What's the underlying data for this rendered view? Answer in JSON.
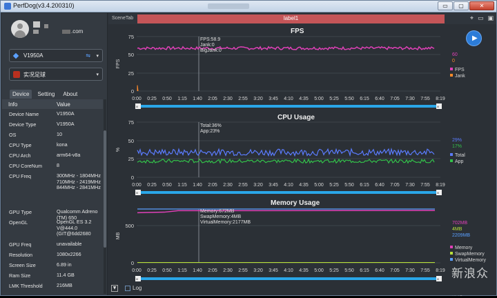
{
  "window": {
    "title": "PerfDog(v3.4.200310)",
    "btn_min": "▭",
    "btn_max": "▢",
    "btn_close": "✕"
  },
  "account": {
    "email_suffix": ".com"
  },
  "device_select": {
    "label": "V1950A",
    "chevron": "▾"
  },
  "app_select": {
    "label": "实况足球",
    "chevron": "▾"
  },
  "tabs": [
    "Device",
    "Setting",
    "About"
  ],
  "info": {
    "header": [
      "Info",
      "Value"
    ],
    "rows": [
      {
        "k": "Device Name",
        "v": "V1950A"
      },
      {
        "k": "Device Type",
        "v": "V1950A"
      },
      {
        "k": "OS",
        "v": "10"
      },
      {
        "k": "CPU Type",
        "v": "kona"
      },
      {
        "k": "CPU Arch",
        "v": "arm64-v8a"
      },
      {
        "k": "CPU CoreNum",
        "v": "8"
      },
      {
        "k": "CPU Freq",
        "v": "300MHz - 1804MHz 710MHz - 2419MHz 844MHz - 2841MHz"
      },
      {
        "k": "GPU Type",
        "v": "Qualcomm Adreno (TM) 650"
      },
      {
        "k": "OpenGL",
        "v": "OpenGL ES 3.2 V@444.0 (GIT@6dd2680"
      },
      {
        "k": "GPU Freq",
        "v": "unavailable"
      },
      {
        "k": "Resolution",
        "v": "1080x2266"
      },
      {
        "k": "Screen Size",
        "v": "6.89 in"
      },
      {
        "k": "Ram Size",
        "v": "11.4 GB"
      },
      {
        "k": "LMK Threshold",
        "v": "216MB"
      }
    ]
  },
  "topbar": {
    "scene_tab": "SceneTab",
    "label": "label1"
  },
  "time_ticks": [
    "0:00",
    "0:25",
    "0:50",
    "1:15",
    "1:40",
    "2:05",
    "2:30",
    "2:55",
    "3:20",
    "3:45",
    "4:10",
    "4:35",
    "5:00",
    "5:25",
    "5:50",
    "6:15",
    "6:40",
    "7:05",
    "7:30",
    "7:55",
    "8:19"
  ],
  "range_handles": {
    "start": "III",
    "end": "III"
  },
  "charts": {
    "fps": {
      "title": "FPS",
      "ylabel": "FPS",
      "yticks": [
        "75",
        "50",
        "25",
        "0"
      ],
      "tooltip": [
        "FPS:58.9",
        "Jank:0",
        "BigJank:0"
      ],
      "right_values": [
        {
          "v": "60",
          "color": "#e040b8"
        },
        {
          "v": "0",
          "color": "#ff8a2a"
        }
      ],
      "legend": [
        {
          "name": "FPS",
          "color": "#e040b8"
        },
        {
          "name": "Jank",
          "color": "#ff8a2a"
        }
      ]
    },
    "cpu": {
      "title": "CPU Usage",
      "ylabel": "%",
      "yticks": [
        "75",
        "50",
        "25",
        "0"
      ],
      "tooltip": [
        "Total:36%",
        "App:23%"
      ],
      "right_values": [
        {
          "v": "29%",
          "color": "#5b7cff"
        },
        {
          "v": "17%",
          "color": "#33c24a"
        }
      ],
      "legend": [
        {
          "name": "Total",
          "color": "#5b7cff"
        },
        {
          "name": "App",
          "color": "#33c24a"
        }
      ]
    },
    "mem": {
      "title": "Memory Usage",
      "ylabel": "MB",
      "yticks": [
        "500",
        "0"
      ],
      "tooltip": [
        "Memory:672MB",
        "SwapMemory:4MB",
        "VirtualMemory:2177MB"
      ],
      "right_values": [
        {
          "v": "702MB",
          "color": "#e040b8"
        },
        {
          "v": "4MB",
          "color": "#b8e03a"
        },
        {
          "v": "2209MB",
          "color": "#5aa0ff"
        }
      ],
      "legend": [
        {
          "name": "Memory",
          "color": "#e040b8"
        },
        {
          "name": "SwapMemory",
          "color": "#b8e03a"
        },
        {
          "name": "VirtualMemory",
          "color": "#5aa0ff"
        }
      ]
    }
  },
  "bottom": {
    "collapse": "▼",
    "log_label": "Log"
  },
  "watermark": "新浪众测"
}
